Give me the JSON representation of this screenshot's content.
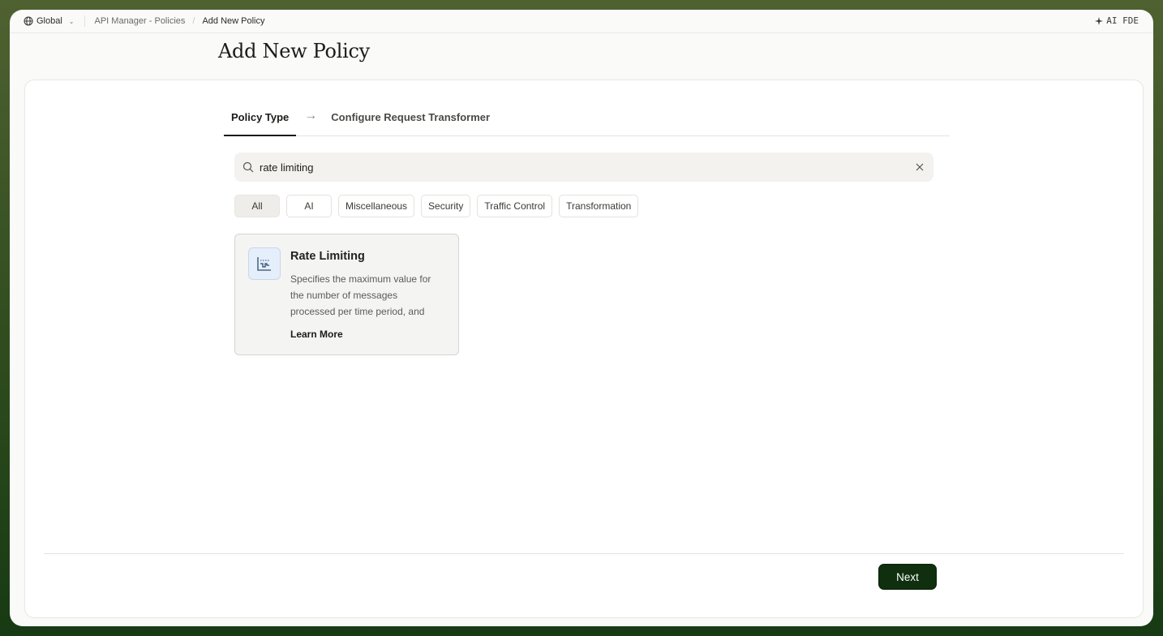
{
  "topbar": {
    "scope_label": "Global",
    "breadcrumbs": [
      "API Manager - Policies",
      "Add New Policy"
    ],
    "ai_label": "AI FDE"
  },
  "page": {
    "title": "Add New Policy"
  },
  "steps": [
    {
      "label": "Policy Type",
      "active": true
    },
    {
      "label": "Configure Request Transformer",
      "active": false
    }
  ],
  "search": {
    "value": "rate limiting",
    "placeholder": ""
  },
  "filters": [
    "All",
    "AI",
    "Miscellaneous",
    "Security",
    "Traffic Control",
    "Transformation"
  ],
  "selected_filter": "All",
  "results": [
    {
      "title": "Rate Limiting",
      "description": "Specifies the maximum value for the number of messages processed per time period, and",
      "link_label": "Learn More",
      "icon": "rate-limit-chart-icon"
    }
  ],
  "footer": {
    "next_label": "Next"
  },
  "colors": {
    "primary_button": "#0f2f0e",
    "icon_tile": "#e5eefb",
    "frame": "#2c4a1c"
  }
}
